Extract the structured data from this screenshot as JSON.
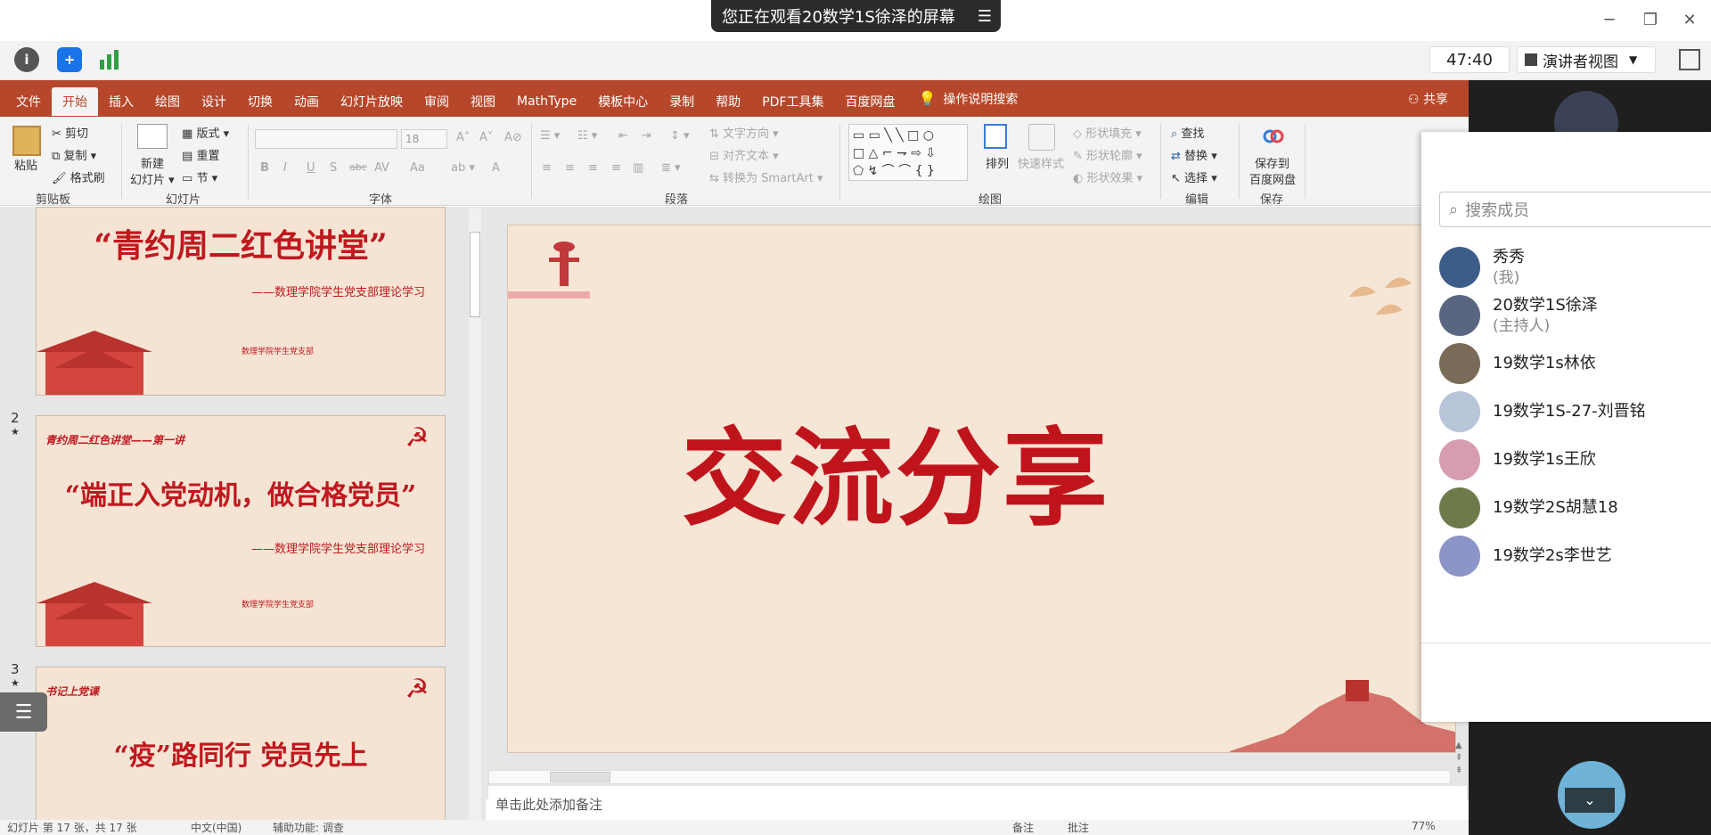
{
  "share_banner": {
    "text": "您正在观看20数学1S徐泽的屏幕",
    "menu_icon": "menu-lines-icon"
  },
  "window_controls": {
    "minimize": "─",
    "restore": "❐",
    "close": "✕"
  },
  "meeting_toolbar": {
    "info_icon": "info-icon",
    "security_icon": "shield-icon",
    "stats_icon": "signal-bars-icon",
    "timer": "47:40",
    "presenter_view": "演讲者视图",
    "fullscreen_icon": "fullscreen-icon"
  },
  "ribbon_tabs": [
    "文件",
    "开始",
    "插入",
    "绘图",
    "设计",
    "切换",
    "动画",
    "幻灯片放映",
    "审阅",
    "视图",
    "MathType",
    "模板中心",
    "录制",
    "帮助",
    "PDF工具集",
    "百度网盘"
  ],
  "ribbon_active_tab": "开始",
  "tell_me": "操作说明搜索",
  "share": "共享",
  "ribbon": {
    "clipboard": {
      "paste": "粘贴",
      "cut": "剪切",
      "copy": "复制",
      "format_painter": "格式刷",
      "label": "剪贴板"
    },
    "slides": {
      "new_slide_1": "新建",
      "new_slide_2": "幻灯片",
      "layout": "版式",
      "reset": "重置",
      "section": "节",
      "label": "幻灯片"
    },
    "font": {
      "size": "18",
      "label": "字体",
      "bold": "B",
      "italic": "I",
      "underline": "U",
      "shadow": "S",
      "strike": "abc",
      "spacing": "AV",
      "case": "Aa",
      "color": "A"
    },
    "paragraph": {
      "text_direction": "文字方向",
      "align_text": "对齐文本",
      "smartart": "转换为 SmartArt",
      "label": "段落"
    },
    "drawing": {
      "arrange": "排列",
      "quick_styles": "快速样式",
      "shape_fill": "形状填充",
      "shape_outline": "形状轮廓",
      "shape_effects": "形状效果",
      "label": "绘图"
    },
    "editing": {
      "find": "查找",
      "replace": "替换",
      "select": "选择",
      "label": "编辑"
    },
    "save": {
      "save_to_1": "保存到",
      "save_to_2": "百度网盘",
      "label": "保存"
    }
  },
  "thumbnails": [
    {
      "number": "",
      "title": "“青约周二红色讲堂”",
      "subtitle": "——数理学院学生党支部理论学习",
      "dept": "数理学院学生党支部"
    },
    {
      "number": "2",
      "star": "★",
      "tag": "青约周二红色讲堂——第一讲",
      "title": "“端正入党动机，做合格党员”",
      "subtitle": "——数理学院学生党支部理论学习",
      "dept": "数理学院学生党支部"
    },
    {
      "number": "3",
      "star": "★",
      "tag": "书记上党课",
      "title": "“疫”路同行  党员先上"
    }
  ],
  "slide": {
    "title": "交流分享"
  },
  "notes_placeholder": "单击此处添加备注",
  "status_bar": {
    "left": "幻灯片 第 17 张，共 17 张",
    "lang": "中文(中国)",
    "access": "辅助功能: 调查",
    "notes": "备注",
    "comments": "批注",
    "zoom": "77%"
  },
  "members_panel": {
    "search_placeholder": "搜索成员",
    "members": [
      {
        "name": "秀秀",
        "role": "(我)",
        "avatar_color": "#3c5d8a"
      },
      {
        "name": "20数学1S徐泽",
        "role": "(主持人)",
        "avatar_color": "#5a6680"
      },
      {
        "name": "19数学1s林依",
        "role": "",
        "avatar_color": "#7a6a58"
      },
      {
        "name": "19数学1S-27-刘晋铭",
        "role": "",
        "avatar_color": "#b8c4d8"
      },
      {
        "name": "19数学1s王欣",
        "role": "",
        "avatar_color": "#d79cb0"
      },
      {
        "name": "19数学2S胡慧18",
        "role": "",
        "avatar_color": "#6d7a4a"
      },
      {
        "name": "19数学2s李世艺",
        "role": "",
        "avatar_color": "#8c94c8"
      }
    ]
  },
  "colors": {
    "ppt_red": "#b7472a",
    "slide_red": "#c0141c",
    "slide_bg": "#f6e6d6"
  }
}
